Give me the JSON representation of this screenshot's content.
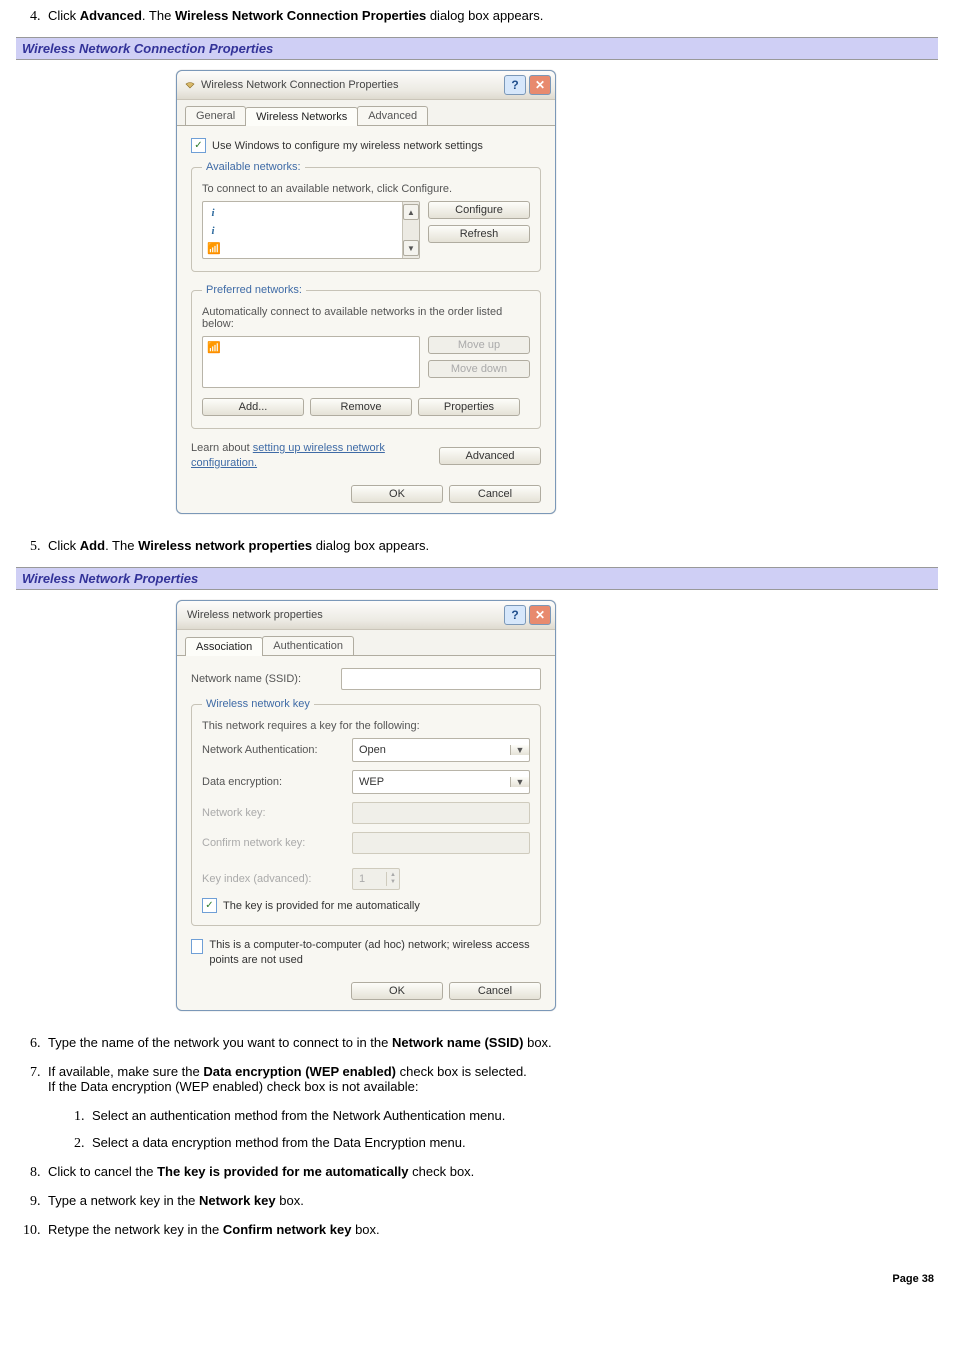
{
  "step4": {
    "pre": "Click ",
    "bold1": "Advanced",
    "mid": ". The ",
    "bold2": "Wireless Network Connection Properties",
    "post": " dialog box appears."
  },
  "header1": "Wireless Network Connection Properties",
  "dialog1": {
    "title": "Wireless Network Connection Properties",
    "tabs": {
      "general": "General",
      "wireless": "Wireless Networks",
      "advanced": "Advanced"
    },
    "use_windows_chk": "Use Windows to configure my wireless network settings",
    "avail_legend": "Available networks:",
    "avail_txt": "To connect to an available network, click Configure.",
    "configure": "Configure",
    "refresh": "Refresh",
    "pref_legend": "Preferred networks:",
    "pref_txt": "Automatically connect to available networks in the order listed below:",
    "moveup": "Move up",
    "movedown": "Move down",
    "add": "Add...",
    "remove": "Remove",
    "properties": "Properties",
    "learn_pre": "Learn about ",
    "learn_link": "setting up wireless network configuration.",
    "advancedbtn": "Advanced",
    "ok": "OK",
    "cancel": "Cancel"
  },
  "step5": {
    "pre": "Click ",
    "bold1": "Add",
    "mid": ". The ",
    "bold2": "Wireless network properties",
    "post": " dialog box appears."
  },
  "header2": "Wireless Network Properties",
  "dialog2": {
    "title": "Wireless network properties",
    "tabs": {
      "assoc": "Association",
      "auth": "Authentication"
    },
    "ssid_label": "Network name (SSID):",
    "key_legend": "Wireless network key",
    "key_txt": "This network requires a key for the following:",
    "auth_label": "Network Authentication:",
    "auth_val": "Open",
    "enc_label": "Data encryption:",
    "enc_val": "WEP",
    "netkey_label": "Network key:",
    "confkey_label": "Confirm network key:",
    "keyidx_label": "Key index (advanced):",
    "keyidx_val": "1",
    "auto_chk": "The key is provided for me automatically",
    "adhoc_chk": "This is a computer-to-computer (ad hoc) network; wireless access points are not used",
    "ok": "OK",
    "cancel": "Cancel"
  },
  "step6": {
    "pre": "Type the name of the network you want to connect to in the ",
    "bold": "Network name (SSID)",
    "post": " box."
  },
  "step7": {
    "pre": "If available, make sure the ",
    "bold": "Data encryption (WEP enabled)",
    "post": " check box is selected.",
    "line2": "If the Data encryption (WEP enabled) check box is not available:",
    "sub1": "Select an authentication method from the Network Authentication menu.",
    "sub2": "Select a data encryption method from the Data Encryption menu."
  },
  "step8": {
    "pre": "Click to cancel the ",
    "bold": "The key is provided for me automatically",
    "post": " check box."
  },
  "step9": {
    "pre": "Type a network key in the ",
    "bold": "Network key",
    "post": " box."
  },
  "step10": {
    "pre": "Retype the network key in the ",
    "bold": "Confirm network key",
    "post": " box."
  },
  "page": "Page 38"
}
